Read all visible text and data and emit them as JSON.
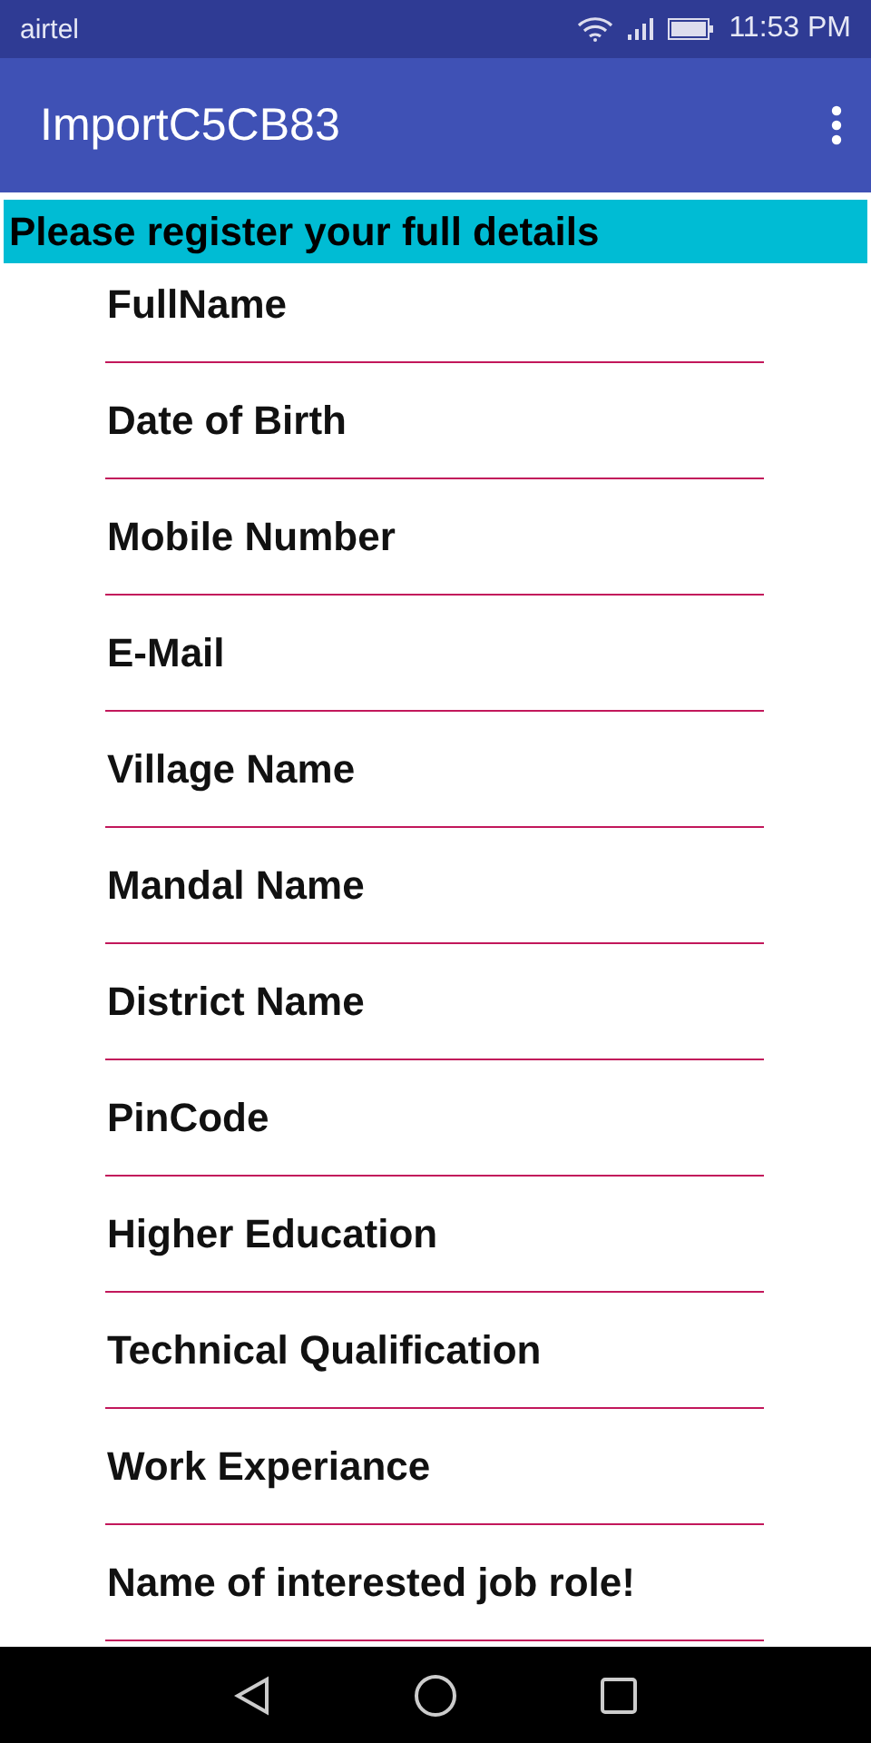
{
  "status_bar": {
    "carrier": "airtel",
    "time": "11:53 PM"
  },
  "app_bar": {
    "title": "ImportC5CB83"
  },
  "banner": "Please register your full details",
  "fields": [
    {
      "placeholder": "FullName"
    },
    {
      "placeholder": "Date of Birth"
    },
    {
      "placeholder": "Mobile Number"
    },
    {
      "placeholder": "E-Mail"
    },
    {
      "placeholder": "Village Name"
    },
    {
      "placeholder": "Mandal Name"
    },
    {
      "placeholder": "District Name"
    },
    {
      "placeholder": "PinCode"
    },
    {
      "placeholder": "Higher Education"
    },
    {
      "placeholder": "Technical Qualification"
    },
    {
      "placeholder": "Work Experiance"
    },
    {
      "placeholder": "Name of interested job role!"
    }
  ]
}
